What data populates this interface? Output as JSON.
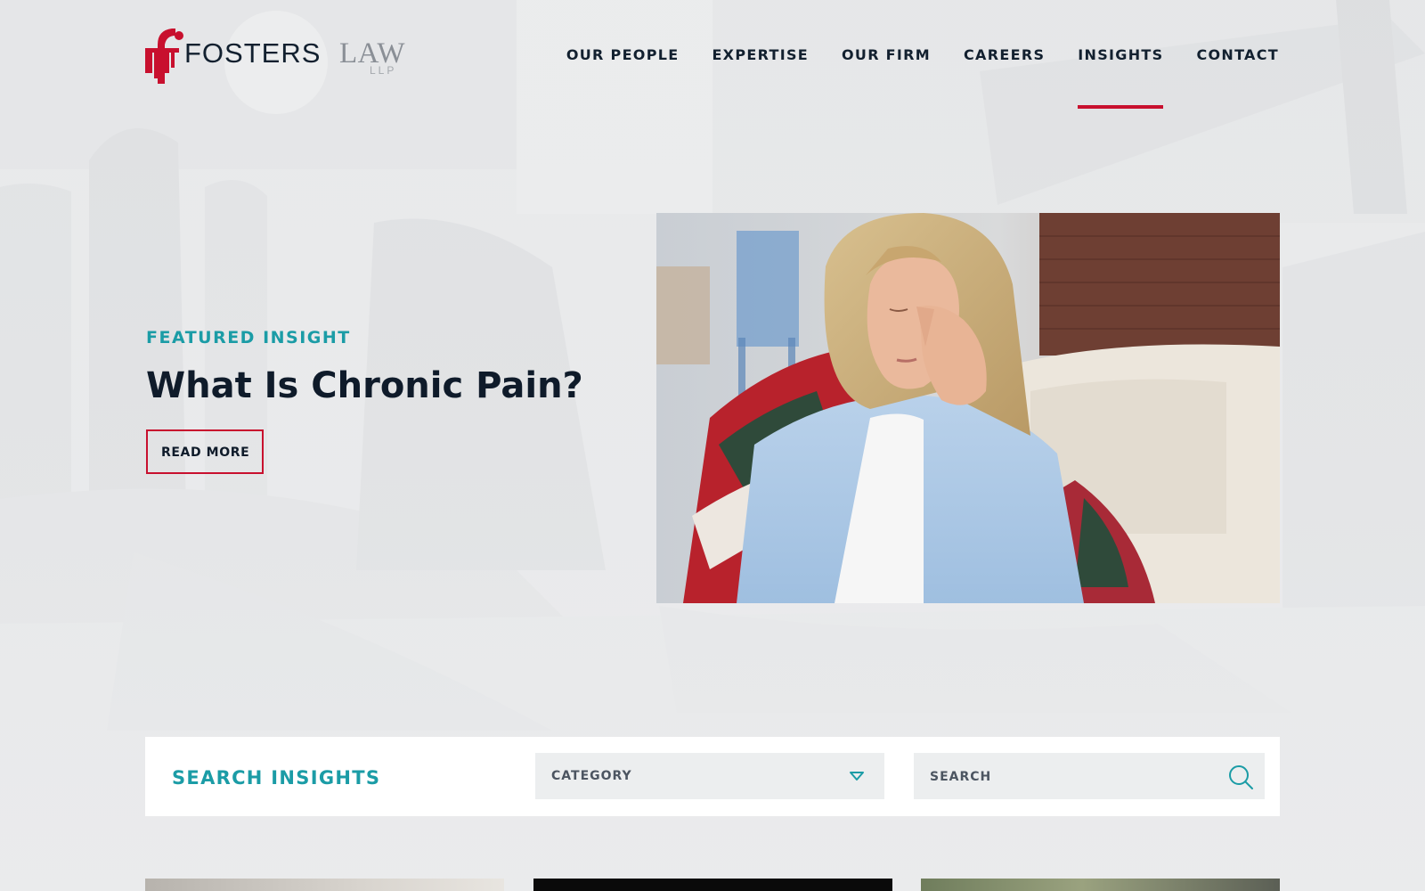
{
  "logo": {
    "name_primary": "FOSTERS",
    "name_secondary": "LAW",
    "suffix": "LLP"
  },
  "nav": {
    "items": [
      {
        "label": "OUR PEOPLE",
        "active": false
      },
      {
        "label": "EXPERTISE",
        "active": false
      },
      {
        "label": "OUR FIRM",
        "active": false
      },
      {
        "label": "CAREERS",
        "active": false
      },
      {
        "label": "INSIGHTS",
        "active": true
      },
      {
        "label": "CONTACT",
        "active": false
      }
    ]
  },
  "hero": {
    "eyebrow": "FEATURED INSIGHT",
    "title": "What Is Chronic Pain?",
    "cta_label": "READ MORE"
  },
  "search_bar": {
    "title": "SEARCH INSIGHTS",
    "category_label": "CATEGORY",
    "search_placeholder": "SEARCH"
  },
  "colors": {
    "accent_red": "#c8102e",
    "accent_teal": "#1b9ca6",
    "text_navy": "#0f1b2a",
    "background": "#eaebec"
  },
  "icons": [
    "logo-f-icon",
    "chevron-down-icon",
    "search-icon"
  ]
}
